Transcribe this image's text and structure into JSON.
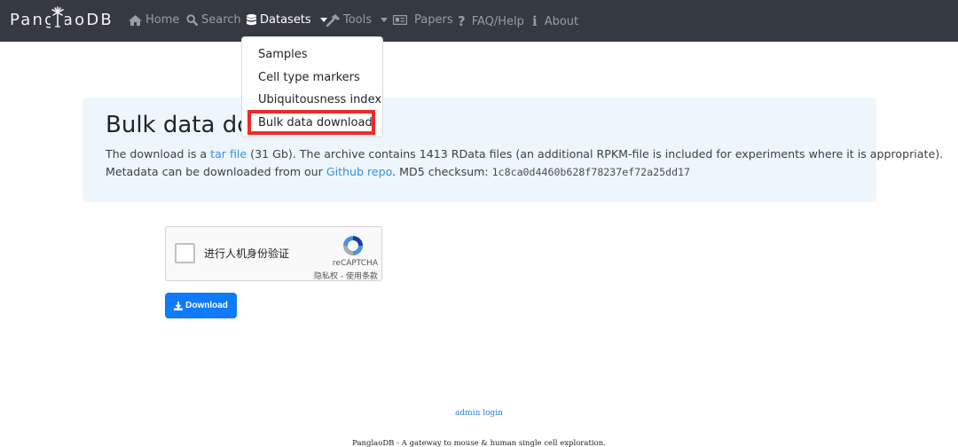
{
  "navbar": {
    "brand": "PanglaoDB",
    "items": [
      {
        "label": "Home",
        "icon": "home-icon"
      },
      {
        "label": "Search",
        "icon": "search-icon"
      },
      {
        "label": "Datasets",
        "icon": "database-icon",
        "dropdown": true,
        "active": true
      },
      {
        "label": "Tools",
        "icon": "hammer-icon",
        "dropdown": true
      },
      {
        "label": "Papers",
        "icon": "newspaper-icon"
      },
      {
        "label": "FAQ/Help",
        "icon": "question-icon"
      },
      {
        "label": "About",
        "icon": "info-icon"
      }
    ]
  },
  "dropdown": {
    "items": [
      "Samples",
      "Cell type markers",
      "Ubiquitousness index",
      "Bulk data download"
    ],
    "highlighted": "Bulk data download",
    "highlight_color": "#ee2a2a"
  },
  "jumbotron": {
    "title": "Bulk data download",
    "line1_pre": "The download is a ",
    "line1_link": "tar file",
    "line1_post": " (31 Gb). The archive contains 1413 RData files (an additional RPKM-file is included for experiments where it is appropriate).",
    "line2_pre": "Metadata can be downloaded from our ",
    "line2_link": "Github repo",
    "line2_mid": ". MD5 checksum: ",
    "checksum": "1c8ca0d4460b628f78237ef72a25dd17"
  },
  "recaptcha": {
    "label": "进行人机身份验证",
    "brand": "reCAPTCHA",
    "terms": "隐私权 - 使用条款"
  },
  "download_button": {
    "label": "Download",
    "icon": "download-icon",
    "color": "#0d7bfb"
  },
  "footer": {
    "admin_login": "admin login",
    "tagline": "PanglaoDB - A gateway to mouse & human single cell exploration."
  },
  "colors": {
    "navbar_bg": "#343a40",
    "jumbotron_bg": "#eef6fd",
    "link": "#3a8ee6"
  }
}
